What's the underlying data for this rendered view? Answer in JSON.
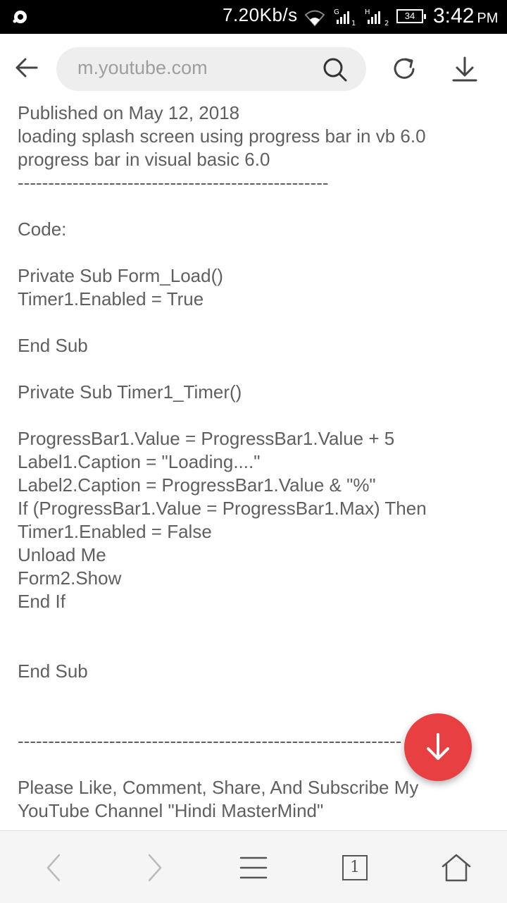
{
  "status_bar": {
    "network_speed": "7.20Kb/s",
    "sim1_label": "G",
    "sim1_index": "1",
    "sim2_label": "H",
    "sim2_index": "2",
    "battery": "34",
    "time": "3:42",
    "ampm": "PM"
  },
  "toolbar": {
    "url": "m.youtube.com"
  },
  "content": {
    "lines": [
      "Published on May 12, 2018",
      "loading splash screen using progress bar in vb 6.0",
      "progress bar in visual basic 6.0",
      "---------------------------------------------------",
      "",
      "Code:",
      "",
      "Private Sub Form_Load()",
      "Timer1.Enabled = True",
      "",
      "End Sub",
      "",
      "Private Sub Timer1_Timer()",
      "",
      "ProgressBar1.Value = ProgressBar1.Value + 5",
      "Label1.Caption = \"Loading....\"",
      "Label2.Caption = ProgressBar1.Value & \"%\"",
      "If (ProgressBar1.Value = ProgressBar1.Max) Then",
      "Timer1.Enabled = False",
      "Unload Me",
      "Form2.Show",
      "End If",
      "",
      "",
      "End Sub",
      "",
      "",
      "---------------------------------------------------------------",
      "",
      "Please Like, Comment, Share, And Subscribe My",
      "YouTube Channel \"Hindi MasterMind\""
    ]
  },
  "bottom_bar": {
    "tab_count": "1"
  },
  "colors": {
    "fab": "#e84042",
    "text": "#5f5f5f"
  }
}
